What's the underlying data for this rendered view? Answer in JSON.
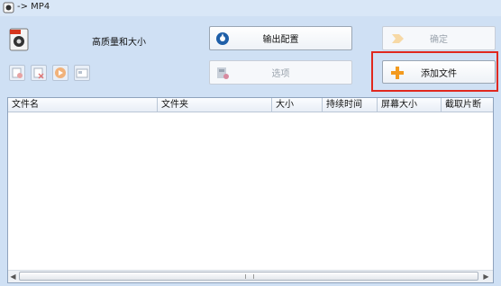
{
  "window": {
    "title": "-> MP4"
  },
  "header": {
    "quality_label": "高质量和大小"
  },
  "buttons": {
    "output_config": "输出配置",
    "ok": "确定",
    "options": "选项",
    "add_file": "添加文件"
  },
  "table": {
    "columns": [
      "文件名",
      "文件夹",
      "大小",
      "持续时间",
      "屏幕大小",
      "截取片断"
    ]
  },
  "colors": {
    "window_bg": "#cfe0f4",
    "highlight_box": "#e0281e",
    "add_icon": "#f39a1e"
  },
  "icons": {
    "app": "app-icon",
    "format": "mp4-format-icon",
    "output_config": "gear-icon",
    "ok": "arrow-right-icon",
    "options": "options-icon",
    "add_file": "plus-icon",
    "tools": [
      "add-item-icon",
      "remove-item-icon",
      "play-icon",
      "info-icon"
    ]
  }
}
